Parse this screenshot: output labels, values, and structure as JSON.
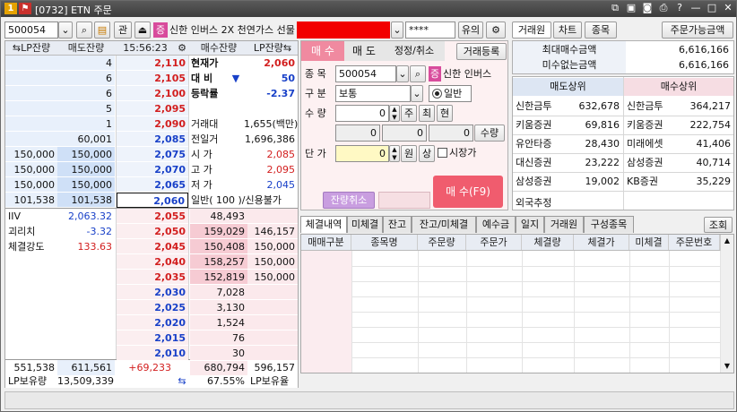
{
  "window": {
    "title": "[0732] ETN 주문",
    "screen_no": "1"
  },
  "code_input": "500054",
  "toolbar": {
    "gwan": "관",
    "jeung": "증",
    "stock_name": "신한 인버스 2X 천연가스 선물",
    "password_mask": "****",
    "yuui": "유의"
  },
  "top_right_buttons": [
    "거래원",
    "차트",
    "종목"
  ],
  "max_order_button": "주문가능금액",
  "orderbook": {
    "headers": [
      "LP잔량",
      "매도잔량",
      "15:56:23",
      "매수잔량",
      "LP잔량"
    ],
    "asks": [
      {
        "lp": "",
        "qty": "4",
        "price": "2,110"
      },
      {
        "lp": "",
        "qty": "6",
        "price": "2,105"
      },
      {
        "lp": "",
        "qty": "6",
        "price": "2,100"
      },
      {
        "lp": "",
        "qty": "5",
        "price": "2,095"
      },
      {
        "lp": "",
        "qty": "1",
        "price": "2,090"
      },
      {
        "lp": "",
        "qty": "60,001",
        "price": "2,085"
      },
      {
        "lp": "150,000",
        "qty": "150,000",
        "price": "2,075"
      },
      {
        "lp": "150,000",
        "qty": "150,000",
        "price": "2,070"
      },
      {
        "lp": "150,000",
        "qty": "150,000",
        "price": "2,065"
      },
      {
        "lp": "101,538",
        "qty": "101,538",
        "price": "2,060"
      }
    ],
    "bids": [
      {
        "price": "2,055",
        "qty": "48,493",
        "lp": ""
      },
      {
        "price": "2,050",
        "qty": "159,029",
        "lp": "146,157"
      },
      {
        "price": "2,045",
        "qty": "150,408",
        "lp": "150,000"
      },
      {
        "price": "2,040",
        "qty": "158,257",
        "lp": "150,000"
      },
      {
        "price": "2,035",
        "qty": "152,819",
        "lp": "150,000"
      },
      {
        "price": "2,030",
        "qty": "7,028",
        "lp": ""
      },
      {
        "price": "2,025",
        "qty": "3,130",
        "lp": ""
      },
      {
        "price": "2,020",
        "qty": "1,524",
        "lp": ""
      },
      {
        "price": "2,015",
        "qty": "76",
        "lp": ""
      },
      {
        "price": "2,010",
        "qty": "30",
        "lp": ""
      }
    ],
    "info": [
      {
        "label": "현재가",
        "value": "2,060",
        "color": "red"
      },
      {
        "label": "대  비",
        "value": "50",
        "arrow": "▼",
        "color": "blue"
      },
      {
        "label": "등락률",
        "value": "-2.37",
        "color": "blue"
      },
      {
        "label": "",
        "value": ""
      },
      {
        "label": "거래대",
        "value": "1,655(백만)"
      },
      {
        "label": "전일거",
        "value": "1,696,386"
      },
      {
        "label": "시  가",
        "value": "2,085",
        "color": "red"
      },
      {
        "label": "고  가",
        "value": "2,095",
        "color": "red"
      },
      {
        "label": "저  가",
        "value": "2,045",
        "color": "blue"
      },
      {
        "label": "일반(  100  )/신용불가",
        "value": ""
      }
    ],
    "left_bottom": [
      {
        "label": "IIV",
        "value": "2,063.32",
        "color": "blue"
      },
      {
        "label": "괴리치",
        "value": "-3.32",
        "color": "blue"
      },
      {
        "label": "체결강도",
        "value": "133.63",
        "color": "red"
      }
    ],
    "totals": {
      "lp_ask": "551,538",
      "ask": "611,561",
      "diff": "+69,233",
      "bid": "680,794",
      "lp_bid": "596,157"
    },
    "lp_hold": {
      "label": "LP보유량",
      "value": "13,509,339",
      "pct": "67.55%",
      "label2": "LP보유율"
    }
  },
  "order": {
    "tabs": [
      "매 수",
      "매 도",
      "정정/취소"
    ],
    "register_button": "거래등록",
    "fields": {
      "code_label": "종 목",
      "code": "500054",
      "name": "신한 인버스",
      "type_label": "구 분",
      "type": "보통",
      "general": "일반",
      "qty_label": "수 량",
      "qty": "0",
      "ju": "주",
      "choe": "최",
      "hyeon": "현",
      "sub1": "0",
      "sub2": "0",
      "sub3": "0",
      "qty_btn": "수량",
      "price_label": "단 가",
      "price": "0",
      "won": "원",
      "sang": "상",
      "market": "시장가",
      "cancel_rest": "잔량취소",
      "submit": "매 수(F9)"
    }
  },
  "summary": {
    "rows": [
      {
        "label": "최대매수금액",
        "value": "6,616,166"
      },
      {
        "label": "미수없는금액",
        "value": "6,616,166"
      }
    ]
  },
  "brokers": {
    "headers": [
      "매도상위",
      "매수상위"
    ],
    "rows": [
      {
        "sell": "신한금투",
        "sell_qty": "632,678",
        "buy": "신한금투",
        "buy_qty": "364,217"
      },
      {
        "sell": "키움증권",
        "sell_qty": "69,816",
        "buy": "키움증권",
        "buy_qty": "222,754"
      },
      {
        "sell": "유안타증",
        "sell_qty": "28,430",
        "buy": "미래에셋",
        "buy_qty": "41,406"
      },
      {
        "sell": "대신증권",
        "sell_qty": "23,222",
        "buy": "삼성증권",
        "buy_qty": "40,714"
      },
      {
        "sell": "삼성증권",
        "sell_qty": "19,002",
        "buy": "KB증권",
        "buy_qty": "35,229"
      }
    ],
    "foreign": "외국추정"
  },
  "bottom_tabs": [
    "체결내역",
    "미체결",
    "잔고",
    "잔고/미체결",
    "예수금",
    "일지",
    "거래원",
    "구성종목"
  ],
  "inquiry_button": "조회",
  "exec_table_headers": [
    "매매구분",
    "종목명",
    "주문량",
    "주문가",
    "체결량",
    "체결가",
    "미체결",
    "주문번호"
  ]
}
